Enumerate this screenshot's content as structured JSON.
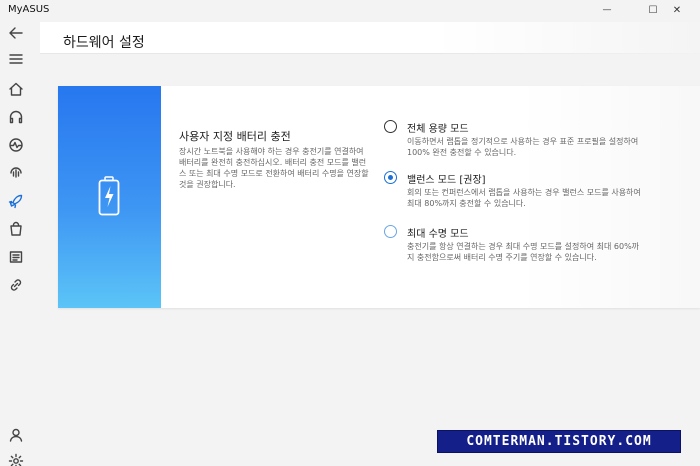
{
  "window": {
    "title": "MyASUS",
    "minimize_glyph": "—",
    "maximize_glyph": "☐",
    "close_glyph": "✕"
  },
  "sidebar": {
    "items": [
      {
        "icon": "back-arrow-icon"
      },
      {
        "icon": "menu-icon"
      },
      {
        "icon": "home-icon"
      },
      {
        "icon": "headset-icon"
      },
      {
        "icon": "diagnostics-icon"
      },
      {
        "icon": "audio-wave-icon"
      },
      {
        "icon": "rocket-icon",
        "active": true
      },
      {
        "icon": "shopping-bag-icon"
      },
      {
        "icon": "news-icon"
      },
      {
        "icon": "link-icon"
      },
      {
        "icon": "user-icon"
      },
      {
        "icon": "gear-icon"
      }
    ]
  },
  "page": {
    "title": "하드웨어 설정"
  },
  "battery_section": {
    "title": "사용자 지정 배터리 충전",
    "description": "장시간 노트북을 사용해야 하는 경우 충전기를 연결하여 배터리를 완전히 충전하십시오. 배터리 충전 모드를 밸런스 또는 최대 수명 모드로 전환하여 배터리 수명을 연장할 것을 권장합니다.",
    "options": [
      {
        "label": "전체 용량 모드",
        "description": "이동하면서 랩톱을 정기적으로 사용하는 경우 표준 프로필을 설정하여 100% 완전 충전할 수 있습니다.",
        "selected": false
      },
      {
        "label": "밸런스 모드 [권장]",
        "description": "회의 또는 컨퍼런스에서 랩톱을 사용하는 경우 밸런스 모드를 사용하여 최대 80%까지 충전할 수 있습니다.",
        "selected": true
      },
      {
        "label": "최대 수명 모드",
        "description": "충전기를 항상 연결하는 경우 최대 수명 모드를 설정하여 최대 60%까지 충전함으로써 배터리 수명 주기를 연장할 수 있습니다.",
        "selected": false
      }
    ]
  },
  "watermark": {
    "text": "COMTERMAN.TISTORY.COM"
  },
  "colors": {
    "accent": "#1a6fd8",
    "panel_top": "#2777ef",
    "panel_bottom": "#5cc4f7",
    "watermark_bg": "#141f8a"
  }
}
